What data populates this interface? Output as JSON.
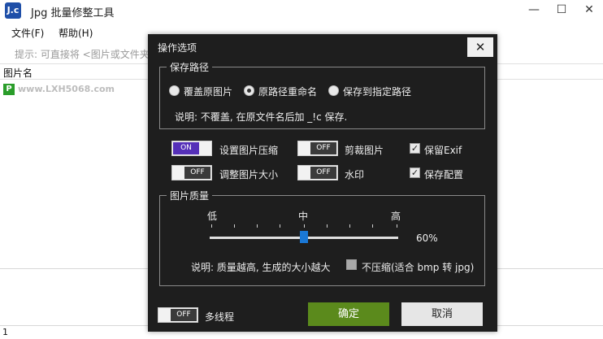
{
  "app": {
    "title": "Jpg 批量修整工具",
    "icon_text": "J.c",
    "window_controls": {
      "minimize": "—",
      "maximize": "☐",
      "close": "✕"
    }
  },
  "menu": {
    "file": "文件(F)",
    "help": "帮助(H)"
  },
  "hint": "提示: 可直接将 <图片或文件夹",
  "list": {
    "column_header": "图片名"
  },
  "watermark": {
    "badge": "P",
    "text": "www.LXH5068.com"
  },
  "statusbar": {
    "count": "1"
  },
  "dialog": {
    "title": "操作选项",
    "close": "✕",
    "save_path": {
      "legend": "保存路径",
      "options": [
        {
          "label": "覆盖原图片",
          "selected": false
        },
        {
          "label": "原路径重命名",
          "selected": true
        },
        {
          "label": "保存到指定路径",
          "selected": false
        }
      ],
      "note": "说明: 不覆盖, 在原文件名后加 _!c 保存."
    },
    "toggles": {
      "compress": {
        "state": "ON",
        "label": "设置图片压缩"
      },
      "crop": {
        "state": "OFF",
        "label": "剪裁图片"
      },
      "resize": {
        "state": "OFF",
        "label": "调整图片大小"
      },
      "watermark": {
        "state": "OFF",
        "label": "水印"
      },
      "multithread": {
        "state": "OFF",
        "label": "多线程"
      }
    },
    "checks": {
      "keep_exif": {
        "label": "保留Exif",
        "checked": true,
        "mark": "✓"
      },
      "save_config": {
        "label": "保存配置",
        "checked": true,
        "mark": "✓"
      }
    },
    "quality": {
      "legend": "图片质量",
      "low": "低",
      "mid": "中",
      "high": "高",
      "value": "60%",
      "note": "说明: 质量越高, 生成的大小越大",
      "no_compress": {
        "label": "不压缩(适合 bmp 转 jpg)",
        "checked": false
      }
    },
    "buttons": {
      "ok": "确定",
      "cancel": "取消"
    }
  },
  "colors": {
    "dialog_bg": "#1e1e1e",
    "toggle_on": "#5530b8",
    "ok_button": "#5b8a1c",
    "slider_thumb": "#1a78d6"
  }
}
